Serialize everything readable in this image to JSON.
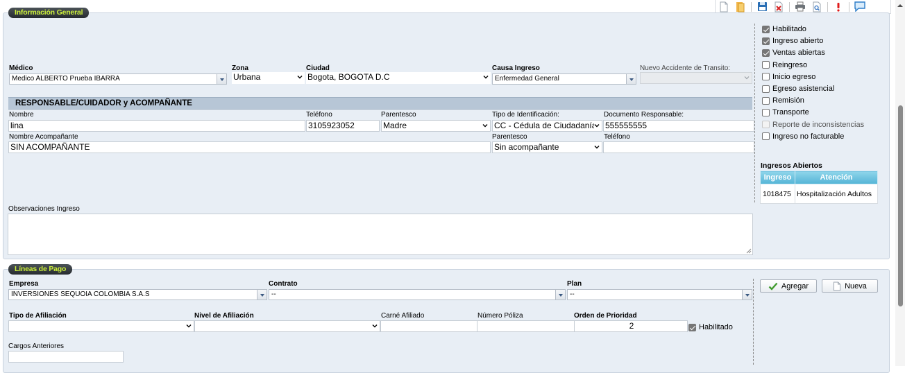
{
  "toolbar": {
    "icons": [
      "new-file-icon",
      "open-folder-icon",
      "save-icon",
      "delete-icon",
      "print-icon",
      "preview-icon",
      "alert-icon",
      "comment-icon"
    ]
  },
  "general": {
    "legend": "Información General",
    "medico_label": "Médico",
    "medico_value": "Medico ALBERTO Prueba IBARRA",
    "zona_label": "Zona",
    "zona_value": "Urbana",
    "ciudad_label": "Ciudad",
    "ciudad_value": "Bogota, BOGOTA D.C",
    "causa_label": "Causa Ingreso",
    "causa_value": "Enfermedad General",
    "accidente_label": "Nuevo Accidente de Transito:",
    "accidente_value": "",
    "responsable_header": "RESPONSABLE/CUIDADOR y ACOMPAÑANTE",
    "nombre_label": "Nombre",
    "nombre_value": "lina",
    "telefono_label": "Teléfono",
    "telefono_value": "3105923052",
    "parentesco_label": "Parentesco",
    "parentesco_value": "Madre",
    "tipo_id_label": "Tipo de Identificación:",
    "tipo_id_value": "CC - Cédula de Ciudadanía",
    "documento_label": "Documento Responsable:",
    "documento_value": "555555555",
    "acompanante_label": "Nombre Acompañante",
    "acompanante_value": "SIN ACOMPAÑANTE",
    "parentesco2_label": "Parentesco",
    "parentesco2_value": "Sin acompañante",
    "telefono2_label": "Teléfono",
    "telefono2_value": "",
    "observaciones_label": "Observaciones Ingreso",
    "observaciones_value": ""
  },
  "flags": [
    {
      "label": "Habilitado",
      "checked": true,
      "disabled": false
    },
    {
      "label": "Ingreso abierto",
      "checked": true,
      "disabled": false
    },
    {
      "label": "Ventas abiertas",
      "checked": true,
      "disabled": false
    },
    {
      "label": "Reingreso",
      "checked": false,
      "disabled": false
    },
    {
      "label": "Inicio egreso",
      "checked": false,
      "disabled": false
    },
    {
      "label": "Egreso asistencial",
      "checked": false,
      "disabled": false
    },
    {
      "label": "Remisión",
      "checked": false,
      "disabled": false
    },
    {
      "label": "Transporte",
      "checked": false,
      "disabled": false
    },
    {
      "label": "Reporte de inconsistencias",
      "checked": false,
      "disabled": true
    },
    {
      "label": "Ingreso no facturable",
      "checked": false,
      "disabled": false
    }
  ],
  "ingresos_abiertos": {
    "title": "Ingresos Abiertos",
    "columns": [
      "Ingreso",
      "Atención"
    ],
    "rows": [
      [
        "1018475",
        "Hospitalización Adultos"
      ]
    ]
  },
  "pago": {
    "legend": "Líneas de Pago",
    "empresa_label": "Empresa",
    "empresa_value": "INVERSIONES SEQUOIA COLOMBIA S.A.S",
    "contrato_label": "Contrato",
    "contrato_value": "--",
    "plan_label": "Plan",
    "plan_value": "--",
    "tipo_afiliacion_label": "Tipo de Afiliación",
    "tipo_afiliacion_value": "",
    "nivel_afiliacion_label": "Nivel de Afiliación",
    "nivel_afiliacion_value": "",
    "carne_label": "Carné Afiliado",
    "carne_value": "",
    "poliza_label": "Número Póliza",
    "poliza_value": "",
    "orden_label": "Orden de Prioridad",
    "orden_value": "2",
    "habilitado_label": "Habilitado",
    "cargos_label": "Cargos Anteriores",
    "cargos_value": "",
    "agregar_label": "Agregar",
    "nueva_label": "Nueva"
  }
}
